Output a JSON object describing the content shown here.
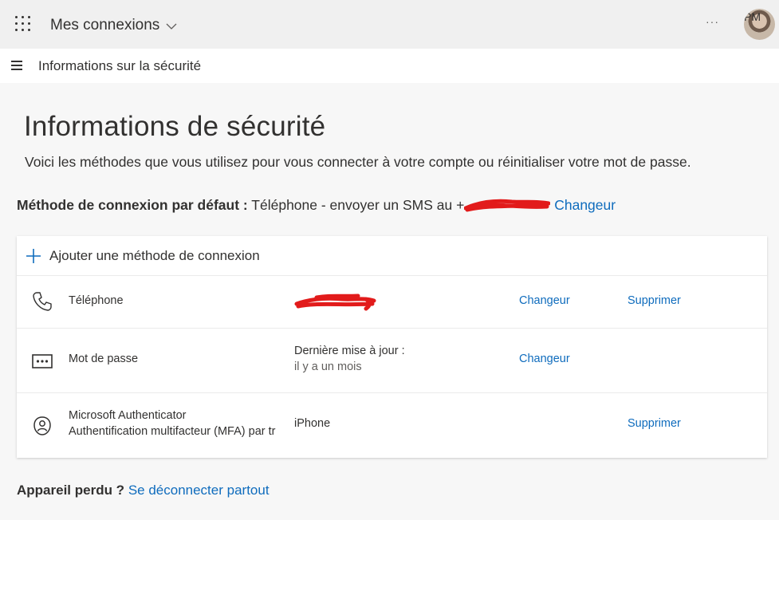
{
  "topbar": {
    "app_switcher_label": "Mes connexions",
    "more_label": "···",
    "avatar_initials": "PM"
  },
  "navbar": {
    "title": "Informations sur la sécurité"
  },
  "page": {
    "title": "Informations de sécurité",
    "subtitle": "Voici les méthodes que vous utilisez pour vous connecter à votre compte ou réinitialiser votre mot de passe.",
    "default_method_label": "Méthode de connexion par défaut :",
    "default_method_value": "Téléphone - envoyer un SMS au +",
    "default_method_change": "Changeur"
  },
  "methods": {
    "add_label": "Ajouter une méthode de connexion",
    "items": [
      {
        "name": "Téléphone",
        "icon": "phone-icon",
        "detail": "",
        "change": "Changeur",
        "delete": "Supprimer"
      },
      {
        "name": "Mot de passe",
        "icon": "password-icon",
        "detail_line1": "Dernière mise à jour :",
        "detail_line2": "il y a un mois",
        "change": "Changeur"
      },
      {
        "name_line1": "Microsoft Authenticator",
        "name_line2": "Authentification multifacteur (MFA) par tr",
        "icon": "authenticator-lock-icon",
        "detail": "iPhone",
        "delete": "Supprimer"
      }
    ]
  },
  "footer": {
    "lost_label": "Appareil perdu ?",
    "signout_link": "Se déconnecter partout"
  },
  "colors": {
    "link": "#0f6cbd",
    "redaction": "#e21b1b",
    "topbar_bg": "#f0f0f0",
    "main_bg": "#f7f7f7"
  }
}
